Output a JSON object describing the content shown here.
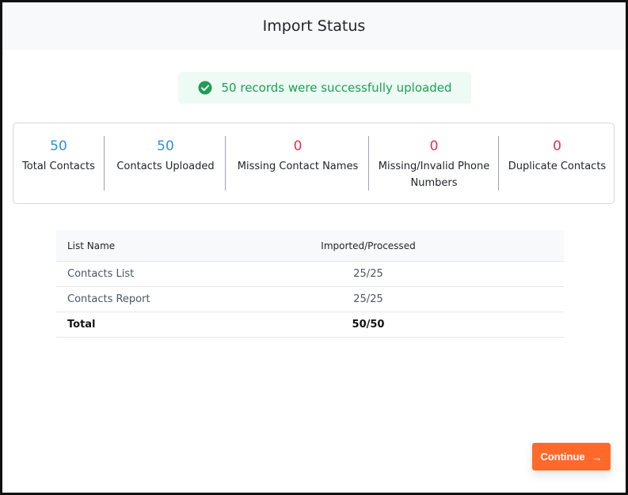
{
  "header": {
    "title": "Import Status"
  },
  "banner": {
    "icon": "check-circle-icon",
    "text": "50 records were successfully uploaded",
    "color": "#1f9d55"
  },
  "stats": [
    {
      "value": "50",
      "label": "Total Contacts",
      "color": "#2f8fd8"
    },
    {
      "value": "50",
      "label": "Contacts Uploaded",
      "color": "#2f8fd8"
    },
    {
      "value": "0",
      "label": "Missing Contact Names",
      "color": "#e0334a"
    },
    {
      "value": "0",
      "label_line1": "Missing/Invalid Phone",
      "label_line2": "Numbers",
      "color": "#e0334a"
    },
    {
      "value": "0",
      "label": "Duplicate Contacts",
      "color": "#e0334a"
    }
  ],
  "table": {
    "headers": [
      "List Name",
      "Imported/Processed"
    ],
    "rows": [
      {
        "name": "Contacts List",
        "value": "25/25"
      },
      {
        "name": "Contacts Report",
        "value": "25/25"
      }
    ],
    "total": {
      "name": "Total",
      "value": "50/50"
    }
  },
  "actions": {
    "continue_label": "Continue",
    "continue_icon": "arrow-right-icon",
    "accent": "#ff6a2b"
  }
}
